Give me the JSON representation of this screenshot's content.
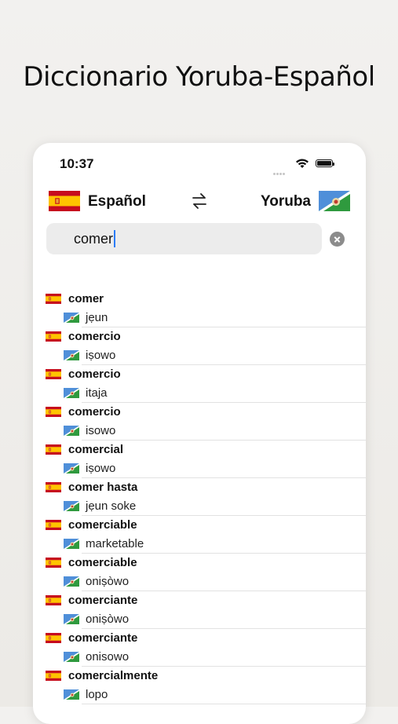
{
  "headline": "Diccionario Yoruba-Español",
  "status_bar": {
    "time": "10:37"
  },
  "languages": {
    "source": "Español",
    "target": "Yoruba"
  },
  "search": {
    "value": "comer"
  },
  "results": [
    {
      "spanish": "comer",
      "yoruba": "jẹun"
    },
    {
      "spanish": "comercio",
      "yoruba": "iṣowo"
    },
    {
      "spanish": "comercio",
      "yoruba": "itaja"
    },
    {
      "spanish": "comercio",
      "yoruba": "isowo"
    },
    {
      "spanish": "comercial",
      "yoruba": "iṣowo"
    },
    {
      "spanish": "comer hasta",
      "yoruba": "jẹun soke"
    },
    {
      "spanish": "comerciable",
      "yoruba": "marketable"
    },
    {
      "spanish": "comerciable",
      "yoruba": "oniṣòwo"
    },
    {
      "spanish": "comerciante",
      "yoruba": "oniṣòwo"
    },
    {
      "spanish": "comerciante",
      "yoruba": "onisowo"
    },
    {
      "spanish": "comercialmente",
      "yoruba": "lopo"
    }
  ]
}
